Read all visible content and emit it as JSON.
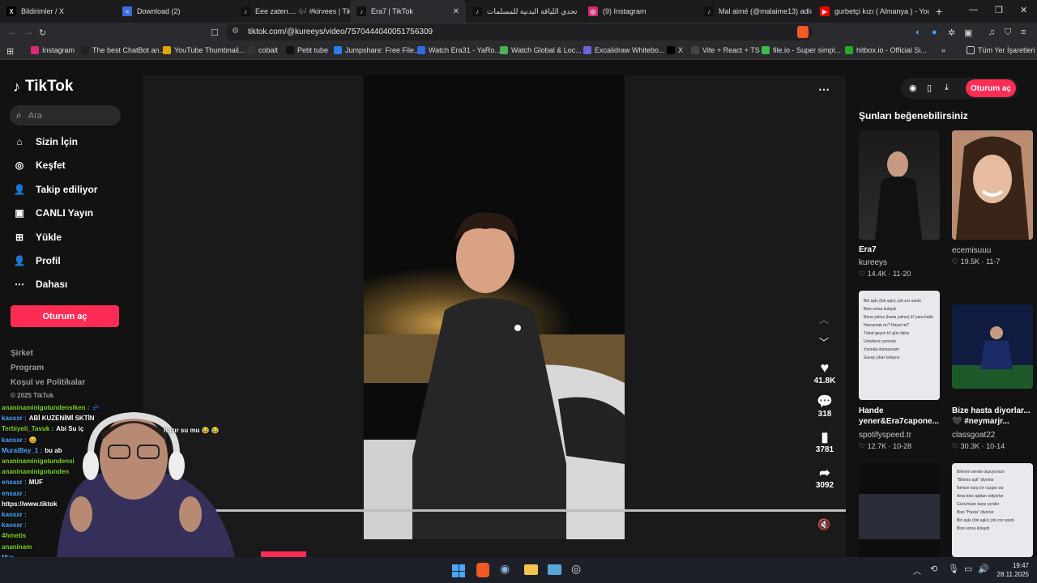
{
  "browser": {
    "tabs": [
      {
        "title": "Bildirimler / X",
        "icon": "x-icon",
        "color": "#000000"
      },
      {
        "title": "Download (2)",
        "icon": "doc-icon",
        "color": "#3b6fd8"
      },
      {
        "title": "Eee zaten.... 🎶 #kirvees | TikTo",
        "icon": "tiktok-icon",
        "color": "#111111"
      },
      {
        "title": "Era7 | TikTok",
        "icon": "tiktok-icon",
        "color": "#111111",
        "active": true
      },
      {
        "title": "تحدي اللياقة البدنية للمسلمات",
        "icon": "tiktok-icon",
        "color": "#111111"
      },
      {
        "title": "(9) Instagram",
        "icon": "instagram-icon",
        "color": "#d62976"
      },
      {
        "title": "Mal aimé (@malaime13) adlı k",
        "icon": "tiktok-icon",
        "color": "#111111"
      },
      {
        "title": "gurbetçi kızı ( Almanya ) - YouT",
        "icon": "youtube-icon",
        "color": "#ff0000"
      }
    ],
    "new_tab": "+",
    "url": "tiktok.com/@kureeys/video/7570444040051756309",
    "bookmarks": [
      {
        "label": "Instagram",
        "color": "#d62976"
      },
      {
        "label": "The best ChatBot an...",
        "color": "#222222"
      },
      {
        "label": "YouTube Thumbnail...",
        "color": "#e2a400"
      },
      {
        "label": "cobalt",
        "color": "#333333"
      },
      {
        "label": "Petit tube",
        "color": "#111111"
      },
      {
        "label": "Jumpshare: Free File...",
        "color": "#2b7de9"
      },
      {
        "label": "Watch Era31 - YaRo...",
        "color": "#2d6cdf"
      },
      {
        "label": "Watch Global & Loc...",
        "color": "#4caf50"
      },
      {
        "label": "Excalidraw Whitebo...",
        "color": "#6965db"
      },
      {
        "label": "X",
        "color": "#000000"
      },
      {
        "label": "Vite + React + TS",
        "color": "#444444"
      },
      {
        "label": "file.io - Super simpl...",
        "color": "#3fb950"
      },
      {
        "label": "hitbox.io - Official Si...",
        "color": "#22aa22"
      }
    ],
    "all_bookmarks": "Tüm Yer İşaretleri"
  },
  "tiktok": {
    "logo": "TikTok",
    "search_placeholder": "Ara",
    "nav": [
      {
        "label": "Sizin İçin",
        "icon": "home-icon"
      },
      {
        "label": "Keşfet",
        "icon": "compass-icon"
      },
      {
        "label": "Takip ediliyor",
        "icon": "following-icon"
      },
      {
        "label": "CANLI Yayın",
        "icon": "live-icon"
      },
      {
        "label": "Yükle",
        "icon": "upload-icon"
      },
      {
        "label": "Profil",
        "icon": "profile-icon"
      },
      {
        "label": "Dahası",
        "icon": "more-icon"
      }
    ],
    "login": "Oturum aç",
    "footer": [
      "Şirket",
      "Program",
      "Koşul ve Politikalar",
      "© 2025 TikTok"
    ],
    "actions": {
      "likes": "41.8K",
      "comments": "318",
      "saves": "3781",
      "shares": "3092"
    },
    "header_login": "Oturum aç",
    "recommend_title": "Şunları beğenebilirsiniz",
    "cards": [
      {
        "title": "Era7",
        "author": "kureeys",
        "meta": "♡ 14.4K · 11-20"
      },
      {
        "title": "",
        "author": "ecemisuuu",
        "meta": "♡ 19.5K · 11-7"
      },
      {
        "title": "Hande yener&Era7capone...",
        "author": "spotifyspeed.tr",
        "meta": "♡ 12.7K · 10-28"
      },
      {
        "title": "Bize hasta diyorlar... 🖤 #neymarjr...",
        "author": "classgoat22",
        "meta": "♡ 30.3K · 10-14"
      }
    ],
    "card_texts": {
      "hande": [
        "Biri aşkı (biri aşkı) çok zor sandı",
        "Bize sorsa kolaydı",
        "Bana yalnız (bana yalnız) bi' yara kaldı",
        "Harcamak mı? Hayal mi?",
        "Tuhaf geçen bi' gün daha",
        "Umutların yarında",
        "Yarında olamazsam",
        "Savaş çıkar kolayca"
      ],
      "lyrics2": [
        "Bilmem sende duyuyorsun",
        "\"Bitmez aşk\" diyorlar",
        "İkimize karşı bi' rüzgar var",
        "Ama bize aşktan ediyorlar",
        "Gücümüze karşı yeniler",
        "Bize \"Hasta\" diyorlar",
        "Biri aşkı (biri aşkı) çok zor sandı",
        "Bize sorsa kolaydı"
      ]
    }
  },
  "chat": [
    {
      "user": "ananinaminigotundensiken :",
      "msg": "💤",
      "color": "#7ed321"
    },
    {
      "user": "kaosxr :",
      "msg": "ABİ KUZENİMİ SKTİN",
      "color": "#4aa8ff"
    },
    {
      "user": "Terbiyeli_Tavuk :",
      "msg": "Abi Su iç",
      "color": "#7ed321"
    },
    {
      "user": "kaosxr :",
      "msg": "😄",
      "color": "#4aa8ff"
    },
    {
      "user": "MuratBey_1 :",
      "msg": "bu ab",
      "color": "#4aa8ff"
    },
    {
      "user": "ananinaminigotundensi",
      "msg": "",
      "color": "#7ed321"
    },
    {
      "user": "ananinaminigotunden",
      "msg": "",
      "color": "#7ed321"
    },
    {
      "user": "ensaxr :",
      "msg": "MUF",
      "color": "#4aa8ff"
    },
    {
      "user": "ensaxr :",
      "msg": "",
      "color": "#4aa8ff"
    },
    {
      "user": "https://www.tiktok",
      "msg": "",
      "color": "#ffffff"
    },
    {
      "user": "kaosxr :",
      "msg": "",
      "color": "#4aa8ff"
    },
    {
      "user": "kaosxr :",
      "msg": "",
      "color": "#4aa8ff"
    },
    {
      "user": "4hmetis",
      "msg": "",
      "color": "#7ed321"
    },
    {
      "user": "ananinam",
      "msg": "",
      "color": "#7ed321"
    },
    {
      "user": "Mur",
      "msg": "",
      "color": "#4aa8ff"
    },
    {
      "user": "4hm",
      "msg": "",
      "color": "#7ed321"
    }
  ],
  "chat_right": {
    "msg": "hazır su mu 😂 😂"
  },
  "taskbar": {
    "time": "19:47",
    "date": "28.11.2025"
  }
}
